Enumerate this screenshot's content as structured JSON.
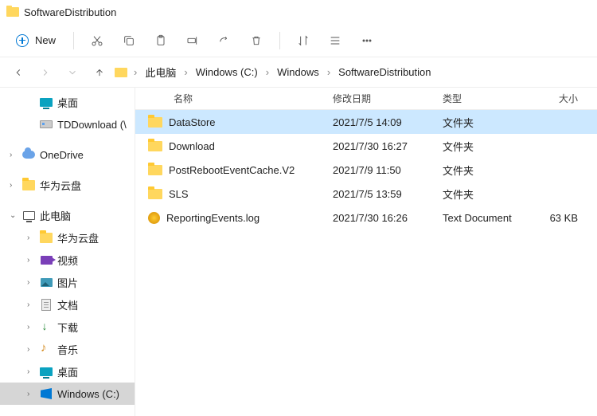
{
  "title": "SoftwareDistribution",
  "toolbar": {
    "new_label": "New"
  },
  "breadcrumb": [
    "此电脑",
    "Windows (C:)",
    "Windows",
    "SoftwareDistribution"
  ],
  "columns": {
    "name": "名称",
    "date": "修改日期",
    "type": "类型",
    "size": "大小"
  },
  "sidebar": [
    {
      "label": "桌面",
      "icon": "desktop",
      "indent": true
    },
    {
      "label": "TDDownload (\\",
      "icon": "disk",
      "indent": true
    },
    {
      "sep": true
    },
    {
      "label": "OneDrive",
      "icon": "cloud",
      "exp": ">"
    },
    {
      "sep": true
    },
    {
      "label": "华为云盘",
      "icon": "folder",
      "exp": ">"
    },
    {
      "sep": true
    },
    {
      "label": "此电脑",
      "icon": "pc",
      "exp": "v"
    },
    {
      "label": "华为云盘",
      "icon": "folder",
      "indent": true,
      "exp": ">"
    },
    {
      "label": "视频",
      "icon": "video",
      "indent": true,
      "exp": ">"
    },
    {
      "label": "图片",
      "icon": "pic",
      "indent": true,
      "exp": ">"
    },
    {
      "label": "文档",
      "icon": "doc",
      "indent": true,
      "exp": ">"
    },
    {
      "label": "下载",
      "icon": "dl",
      "indent": true,
      "exp": ">"
    },
    {
      "label": "音乐",
      "icon": "music",
      "indent": true,
      "exp": ">"
    },
    {
      "label": "桌面",
      "icon": "desktop",
      "indent": true,
      "exp": ">"
    },
    {
      "label": "Windows (C:)",
      "icon": "win",
      "indent": true,
      "exp": ">",
      "selected": true
    }
  ],
  "rows": [
    {
      "name": "DataStore",
      "date": "2021/7/5 14:09",
      "type": "文件夹",
      "size": "",
      "icon": "folder",
      "selected": true
    },
    {
      "name": "Download",
      "date": "2021/7/30 16:27",
      "type": "文件夹",
      "size": "",
      "icon": "folder"
    },
    {
      "name": "PostRebootEventCache.V2",
      "date": "2021/7/9 11:50",
      "type": "文件夹",
      "size": "",
      "icon": "folder"
    },
    {
      "name": "SLS",
      "date": "2021/7/5 13:59",
      "type": "文件夹",
      "size": "",
      "icon": "folder"
    },
    {
      "name": "ReportingEvents.log",
      "date": "2021/7/30 16:26",
      "type": "Text Document",
      "size": "63 KB",
      "icon": "log"
    }
  ]
}
